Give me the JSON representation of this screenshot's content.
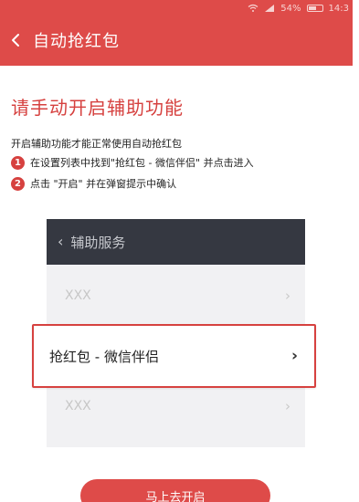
{
  "status_bar": {
    "battery_text": "54%",
    "time": "14:3"
  },
  "header": {
    "back_icon": "chevron-left-icon",
    "title": "自动抢红包"
  },
  "guide": {
    "title": "请手动开启辅助功能",
    "intro": "开启辅助功能才能正常使用自动抢红包",
    "steps": [
      {
        "number": "1",
        "text": "在设置列表中找到\"抢红包 - 微信伴侣\" 并点击进入"
      },
      {
        "number": "2",
        "text": "点击 \"开启\" 并在弹窗提示中确认"
      }
    ]
  },
  "panel": {
    "title": "辅助服务",
    "rows": [
      {
        "label": "XXX"
      },
      {
        "label": "抢红包 - 微信伴侣"
      },
      {
        "label": "XXX"
      }
    ]
  },
  "action": {
    "button_label": "马上去开启"
  },
  "colors": {
    "brand_red": "#de4b49",
    "dark_header": "#353841",
    "panel_bg": "#f1f1f3"
  }
}
